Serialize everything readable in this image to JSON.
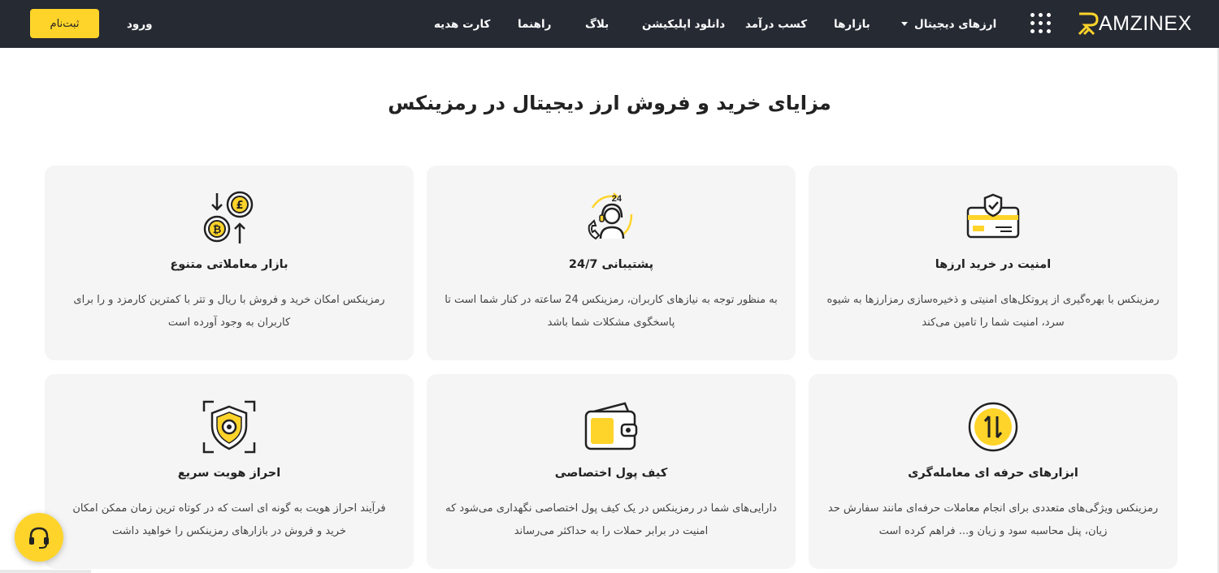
{
  "brand": {
    "logo_text": "AMZINEX",
    "accent": "#ffd42a",
    "header_bg": "#262a33"
  },
  "nav": {
    "digital_currencies": "ارزهای دیجیتال",
    "markets": "بازارها",
    "earn": "کسب درآمد",
    "download_app": "دانلود اپلیکیشن",
    "blog": "بلاگ",
    "guide": "راهنما",
    "gift_card": "کارت هدیه",
    "login": "ورود",
    "register": "ثبت‌نام"
  },
  "section": {
    "title": "مزایای خرید و فروش ارز دیجیتال در رمزینکس"
  },
  "features": [
    {
      "icon": "secure-card-icon",
      "title": "امنیت در خرید ارزها",
      "desc": "رمزینکس با بهره‌گیری از پروتکل‌های امنیتی و ذخیره‌سازی رمزارزها به شیوه سرد، امنیت شما را تامین می‌کند"
    },
    {
      "icon": "support-24-icon",
      "title": "پشتیبانی 24/7",
      "desc": "به منظور توجه به نیازهای کاربران، رمزینکس 24 ساعته در کنار شما است تا پاسخگوی مشکلات شما باشد"
    },
    {
      "icon": "exchange-coins-icon",
      "title": "بازار معاملاتی متنوع",
      "desc": "رمزینکس امکان خرید و فروش با ریال و تتر با کمترین کارمزد و را برای کاربران به وجود آورده است"
    },
    {
      "icon": "trade-arrows-icon",
      "title": "ابزارهای حرفه ای معامله‌گری",
      "desc": "رمزینکس ویژگی‌های متعددی برای انجام معاملات حرفه‌ای مانند سفارش حد زیان، پنل محاسبه سود و زیان و... فراهم کرده است"
    },
    {
      "icon": "wallet-icon",
      "title": "کیف پول اختصاصی",
      "desc": "دارایی‌های شما در رمزینکس در یک کیف پول اختصاصی نگهداری می‌شود که امنیت در برابر حملات را به حداکثر می‌رساند"
    },
    {
      "icon": "identity-shield-icon",
      "title": "احراز هویت سریع",
      "desc": "فرآیند احراز هویت به گونه ای است که در کوتاه ترین زمان ممکن امکان خرید و فروش در بازارهای رمزینکس را خواهید داشت"
    }
  ]
}
